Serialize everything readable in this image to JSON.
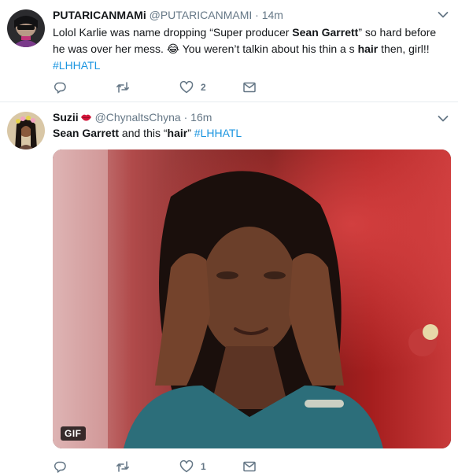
{
  "tweets": [
    {
      "display_name": "PUTARICANMAMi",
      "handle": "@PUTARICANMAMI",
      "separator": "·",
      "time": "14m",
      "text_parts": {
        "p1": "Lolol Karlie was name dropping “Super producer ",
        "b1": "Sean Garrett",
        "p2": "” so hard before he was over her mess. ",
        "emoji": "😂",
        "p3": " You weren’t talkin about his thin a  s ",
        "b2": "hair",
        "p4": " then, girl!!",
        "hashtag": "#LHHATL"
      },
      "actions": {
        "reply_count": "",
        "retweet_count": "",
        "like_count": "2"
      },
      "icons": {
        "reply": "reply-icon",
        "retweet": "retweet-icon",
        "like": "heart-icon",
        "dm": "envelope-icon",
        "menu": "chevron-down-icon"
      }
    },
    {
      "display_name": "Suzii",
      "handle": "@ChynaltsChyna",
      "separator": "·",
      "time": "16m",
      "text_parts": {
        "b1": "Sean Garrett",
        "p1": " and this “",
        "b2": "hair",
        "p2": "” ",
        "hashtag": "#LHHATL"
      },
      "media": {
        "badge": "GIF"
      },
      "actions": {
        "reply_count": "",
        "retweet_count": "",
        "like_count": "1"
      },
      "icons": {
        "reply": "reply-icon",
        "retweet": "retweet-icon",
        "like": "heart-icon",
        "dm": "envelope-icon",
        "menu": "chevron-down-icon",
        "name_emoji": "lips-emoji"
      }
    }
  ],
  "colors": {
    "link": "#1b95e0",
    "muted": "#657786",
    "text": "#14171a",
    "divider": "#e6ecf0"
  }
}
